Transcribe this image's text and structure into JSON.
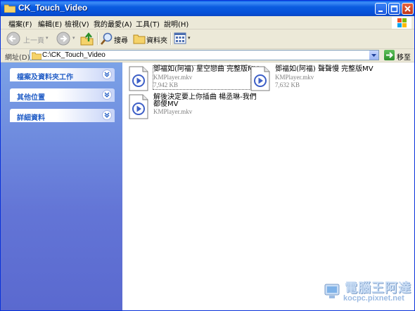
{
  "window": {
    "title": "CK_Touch_Video"
  },
  "menu": [
    "檔案(F)",
    "編輯(E)",
    "檢視(V)",
    "我的最愛(A)",
    "工具(T)",
    "說明(H)"
  ],
  "toolbar": {
    "back_label": "上一頁",
    "search_label": "搜尋",
    "folders_label": "資料夾"
  },
  "address": {
    "label": "網址(D)",
    "value": "C:\\CK_Touch_Video",
    "go_label": "移至"
  },
  "tasks": {
    "file_tasks": "檔案及資料夾工作",
    "other_places": "其他位置",
    "details": "詳細資料"
  },
  "files": [
    {
      "name": "鄧福如(阿福) 星空戀曲 完整版MV",
      "type": "KMPlayer.mkv",
      "size": "7,942 KB"
    },
    {
      "name": "鄧福如(阿福) 聲聲慢 完整版MV",
      "type": "KMPlayer.mkv",
      "size": "7,632 KB"
    },
    {
      "name1": "解後決定要上你插曲 楊丞琳-我們",
      "name2": "都傻MV",
      "type": "KMPlayer.mkv"
    }
  ],
  "watermark": {
    "line1": "電腦王阿達",
    "line2": "kocpc.pixnet.net"
  }
}
